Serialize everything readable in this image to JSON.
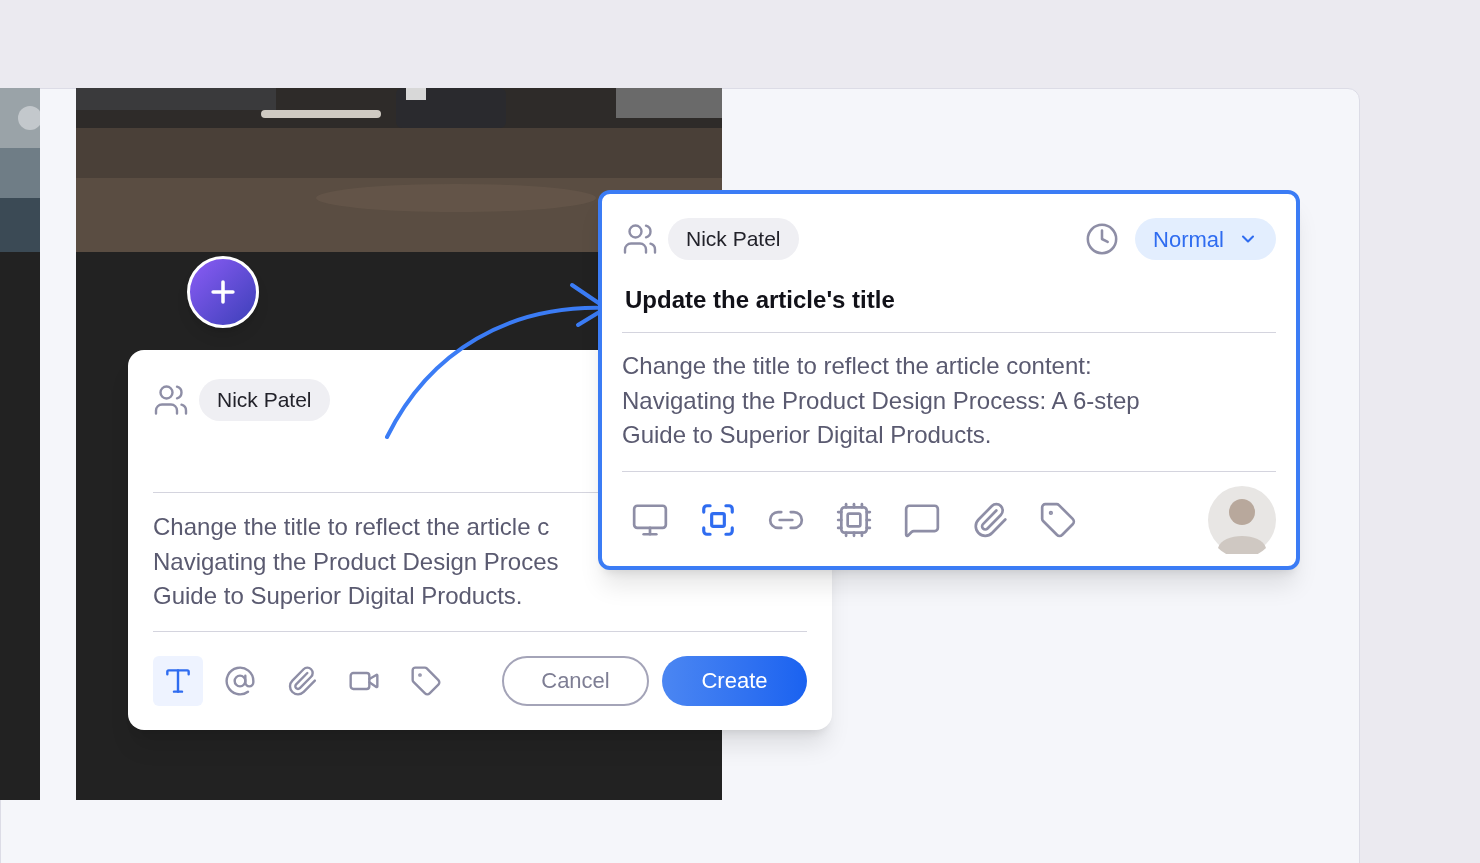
{
  "draft_card": {
    "assignee": "Nick Patel",
    "description_lines": [
      "Change the title to reflect the article c",
      "Navigating the Product Design Proces",
      "Guide to Superior Digital Products."
    ],
    "tools": [
      {
        "selected": true
      },
      {
        "selected": false
      },
      {
        "selected": false
      },
      {
        "selected": false
      },
      {
        "selected": false
      }
    ],
    "cancel_button": "Cancel",
    "create_button": "Create"
  },
  "task_card": {
    "assignee": "Nick Patel",
    "priority": "Normal",
    "title": "Update the article's title",
    "description_lines": [
      "Change the title to reflect the article content:",
      "Navigating the Product Design Process: A 6-step",
      "Guide to Superior Digital Products."
    ],
    "tools": [
      {
        "selected": false
      },
      {
        "selected": true
      },
      {
        "selected": false
      },
      {
        "selected": false
      },
      {
        "selected": false
      },
      {
        "selected": false
      },
      {
        "selected": false
      }
    ]
  }
}
